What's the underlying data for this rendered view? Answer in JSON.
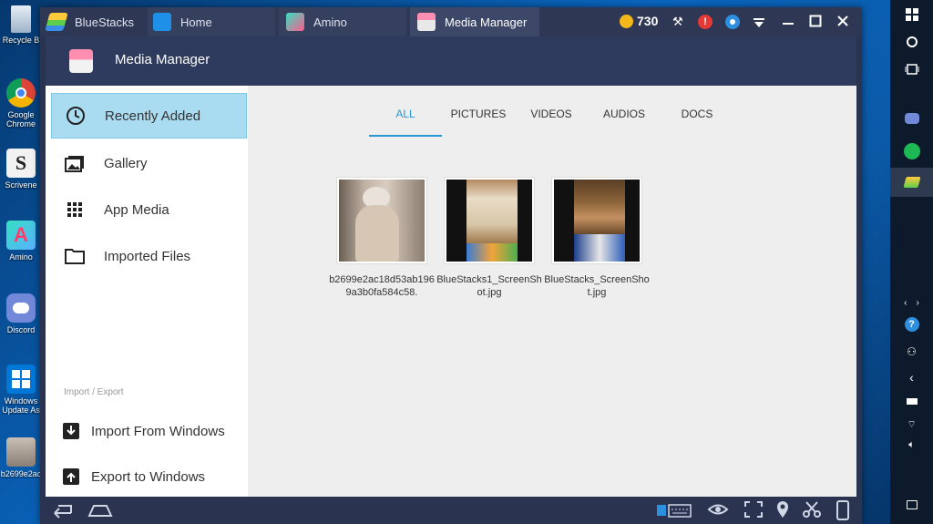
{
  "desktop": {
    "icons": [
      {
        "label": "Recycle B",
        "icon": "recycle-bin-icon"
      },
      {
        "label": "Google Chrome",
        "icon": "chrome-icon"
      },
      {
        "label": "Scrivene",
        "icon": "scrivener-icon"
      },
      {
        "label": "Amino",
        "icon": "amino-icon"
      },
      {
        "label": "Discord",
        "icon": "discord-icon"
      },
      {
        "label": "Windows Update As",
        "icon": "windows-update-icon"
      },
      {
        "label": "b2699e2ac",
        "icon": "image-file-icon"
      }
    ]
  },
  "titlebar": {
    "app_name": "BlueStacks",
    "tabs": [
      {
        "label": "Home"
      },
      {
        "label": "Amino"
      },
      {
        "label": "Media Manager"
      }
    ],
    "coins": "730"
  },
  "app": {
    "title": "Media Manager"
  },
  "sidebar": {
    "items": [
      {
        "label": "Recently Added",
        "icon": "clock-icon"
      },
      {
        "label": "Gallery",
        "icon": "gallery-icon"
      },
      {
        "label": "App Media",
        "icon": "grid-icon"
      },
      {
        "label": "Imported Files",
        "icon": "folder-icon"
      }
    ],
    "section_label": "Import / Export",
    "import_label": "Import From Windows",
    "export_label": "Export to Windows"
  },
  "filter_tabs": [
    "ALL",
    "PICTURES",
    "VIDEOS",
    "AUDIOS",
    "DOCS"
  ],
  "media": [
    {
      "caption": "b2699e2ac18d53ab1969a3b0fa584c58."
    },
    {
      "caption": "BlueStacks1_ScreenShot.jpg"
    },
    {
      "caption": "BlueStacks_ScreenShot.jpg"
    }
  ],
  "colors": {
    "accent": "#2a97d4",
    "header": "#2f3b5e",
    "selected": "#a9dcf0"
  }
}
